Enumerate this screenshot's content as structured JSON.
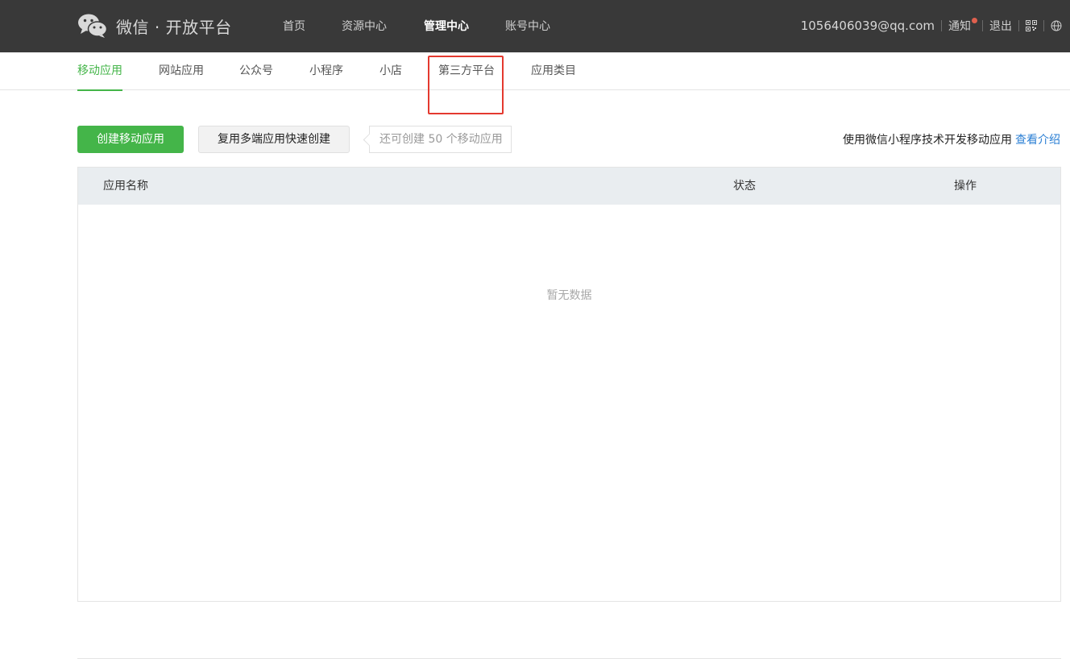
{
  "header": {
    "logo_text": "微信 · 开放平台",
    "nav": [
      {
        "label": "首页",
        "active": false
      },
      {
        "label": "资源中心",
        "active": false
      },
      {
        "label": "管理中心",
        "active": true
      },
      {
        "label": "账号中心",
        "active": false
      }
    ],
    "email": "1056406039@qq.com",
    "notify_label": "通知",
    "logout_label": "退出",
    "notify_dot_color": "#e0604e",
    "icons": [
      "qrcode-icon",
      "globe-icon"
    ]
  },
  "subnav": {
    "tabs": [
      {
        "label": "移动应用",
        "active": true
      },
      {
        "label": "网站应用",
        "active": false
      },
      {
        "label": "公众号",
        "active": false
      },
      {
        "label": "小程序",
        "active": false
      },
      {
        "label": "小店",
        "active": false
      },
      {
        "label": "第三方平台",
        "active": false
      },
      {
        "label": "应用类目",
        "active": false
      }
    ],
    "accent_color": "#44b549"
  },
  "toolbar": {
    "create_label": "创建移动应用",
    "quick_create_label": "复用多端应用快速创建",
    "remaining_tip": "还可创建 50 个移动应用",
    "intro_text": "使用微信小程序技术开发移动应用",
    "intro_link": "查看介绍"
  },
  "table": {
    "columns": [
      "应用名称",
      "状态",
      "操作"
    ],
    "empty_text": "暂无数据"
  }
}
